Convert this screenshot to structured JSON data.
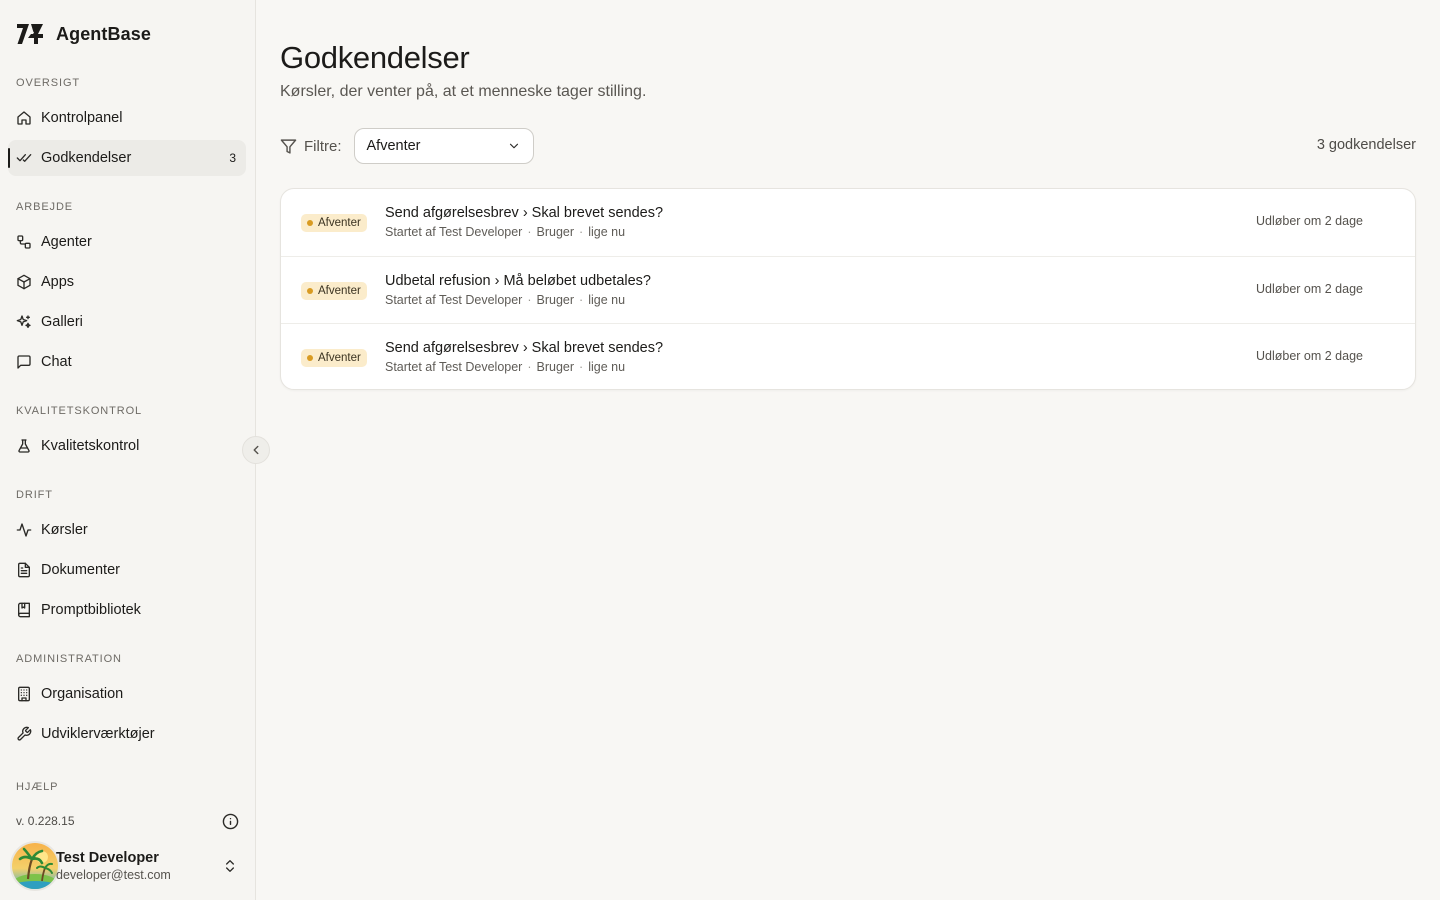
{
  "app": {
    "name": "AgentBase"
  },
  "sidebar": {
    "sections": {
      "overview": "OVERSIGT",
      "work": "ARBEJDE",
      "quality": "KVALITETSKONTROL",
      "operations": "DRIFT",
      "administration": "ADMINISTRATION",
      "help": "HJÆLP"
    },
    "items": {
      "dashboard": {
        "label": "Kontrolpanel",
        "icon": "home-icon"
      },
      "approvals": {
        "label": "Godkendelser",
        "icon": "check-check-icon",
        "badge": "3",
        "active": true
      },
      "agents": {
        "label": "Agenter",
        "icon": "workflow-icon"
      },
      "apps": {
        "label": "Apps",
        "icon": "box-icon"
      },
      "gallery": {
        "label": "Galleri",
        "icon": "sparkles-icon"
      },
      "chat": {
        "label": "Chat",
        "icon": "message-square-icon"
      },
      "quality": {
        "label": "Kvalitetskontrol",
        "icon": "flask-icon"
      },
      "runs": {
        "label": "Kørsler",
        "icon": "activity-icon"
      },
      "documents": {
        "label": "Dokumenter",
        "icon": "file-text-icon"
      },
      "prompts": {
        "label": "Promptbibliotek",
        "icon": "book-icon"
      },
      "organization": {
        "label": "Organisation",
        "icon": "building-icon"
      },
      "devtools": {
        "label": "Udviklerværktøjer",
        "icon": "wrench-icon"
      }
    },
    "version": "v. 0.228.15",
    "user": {
      "name": "Test Developer",
      "email": "developer@test.com"
    }
  },
  "main": {
    "title": "Godkendelser",
    "subtitle": "Kørsler, der venter på, at et menneske tager stilling.",
    "filter": {
      "label": "Filtre:",
      "selected": "Afventer"
    },
    "count": "3 godkendelser",
    "approvals": [
      {
        "status": "Afventer",
        "title": "Send afgørelsesbrev › Skal brevet sendes?",
        "started_by": "Startet af Test Developer",
        "role": "Bruger",
        "when": "lige nu",
        "expiry": "Udløber om 2 dage"
      },
      {
        "status": "Afventer",
        "title": "Udbetal refusion › Må beløbet udbetales?",
        "started_by": "Startet af Test Developer",
        "role": "Bruger",
        "when": "lige nu",
        "expiry": "Udløber om 2 dage"
      },
      {
        "status": "Afventer",
        "title": "Send afgørelsesbrev › Skal brevet sendes?",
        "started_by": "Startet af Test Developer",
        "role": "Bruger",
        "when": "lige nu",
        "expiry": "Udløber om 2 dage"
      }
    ]
  },
  "colors": {
    "background": "#f8f7f4",
    "sidebar": "#f6f5f2",
    "status_badge_bg": "#fbeccb",
    "status_dot": "#d99b22",
    "text": "#1c1b19"
  }
}
